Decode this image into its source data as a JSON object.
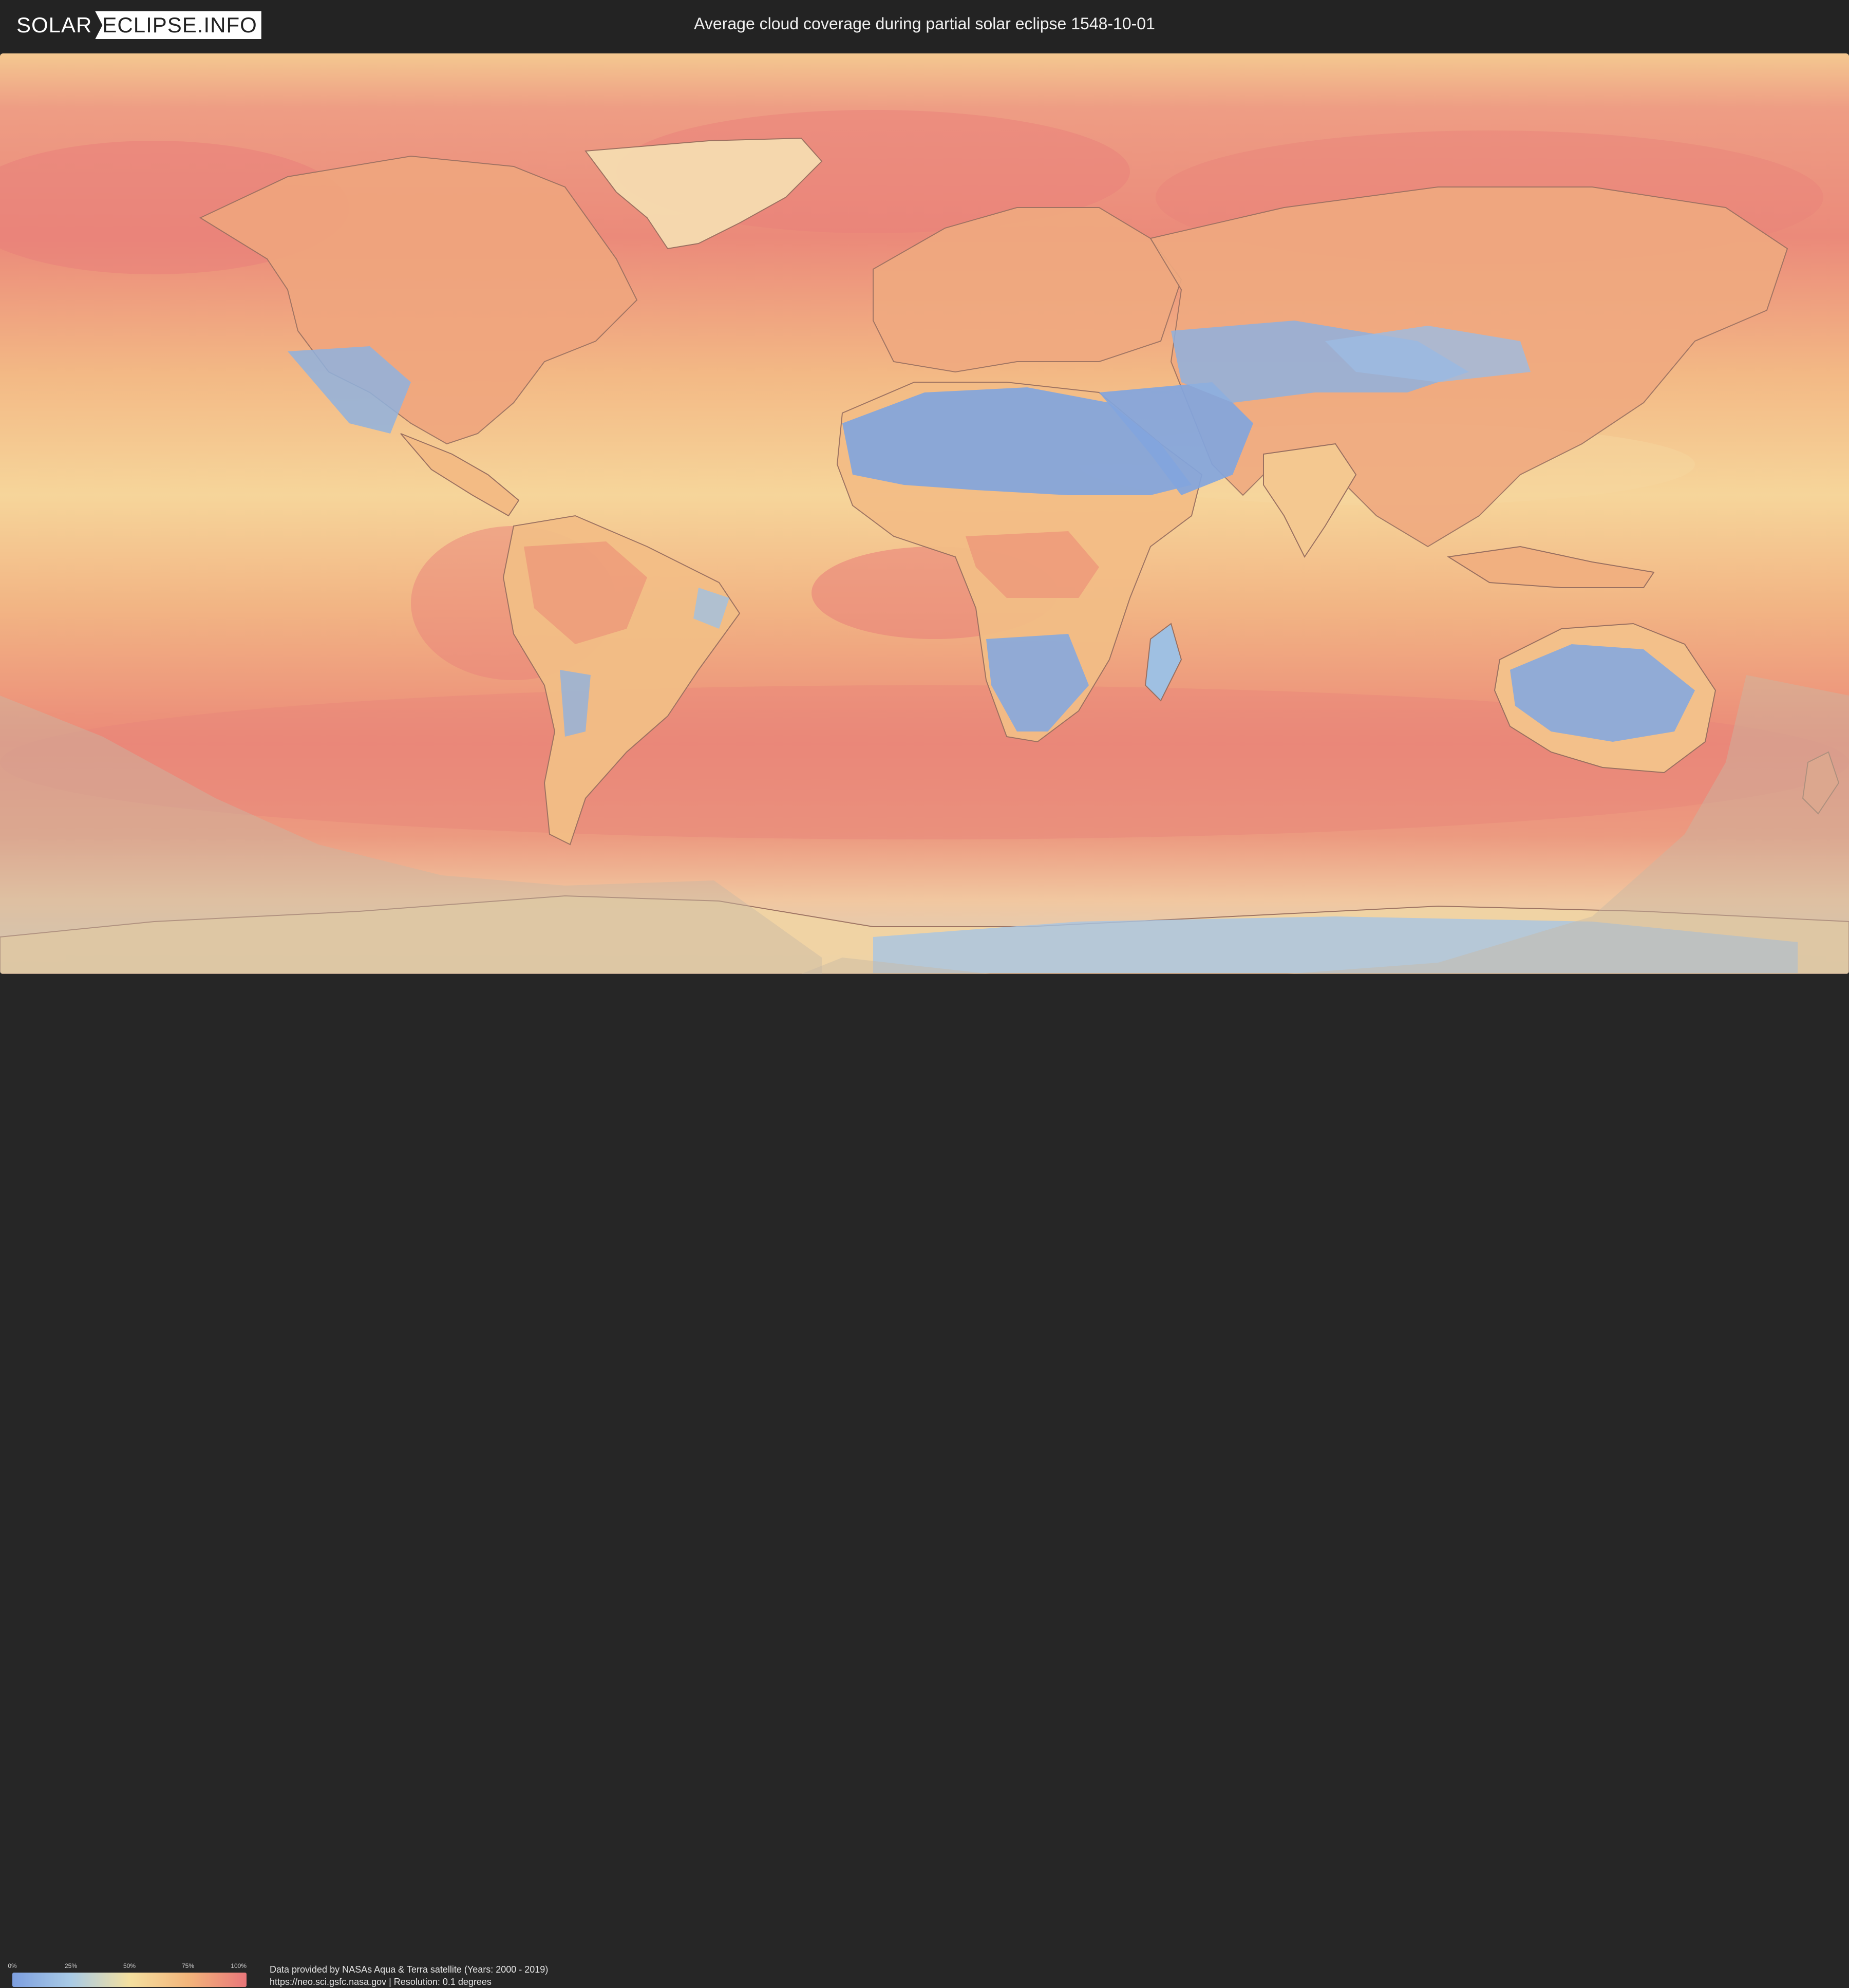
{
  "header": {
    "logo_part1": "SOLAR",
    "logo_part2": "ECLIPSE.INFO",
    "title": "Average cloud coverage during partial solar eclipse 1548-10-01"
  },
  "legend": {
    "ticks": [
      "0%",
      "25%",
      "50%",
      "75%",
      "100%"
    ],
    "colors": [
      "#7d9fe0",
      "#a9cbe6",
      "#f4e0a0",
      "#f3b57b",
      "#e9777a"
    ]
  },
  "credits": {
    "line1": "Data provided by NASAs Aqua & Terra satellite (Years: 2000 - 2019)",
    "line2": "https://neo.sci.gsfc.nasa.gov | Resolution: 0.1 degrees"
  },
  "map": {
    "ocean_cloud_color": "#ee9378",
    "desert_clear_color": "#7ea3dc",
    "eclipse_shadow_color": "#c8b9a3"
  }
}
